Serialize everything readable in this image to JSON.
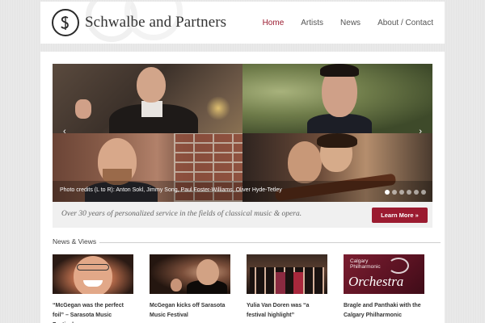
{
  "brand": {
    "name": "Schwalbe and Partners",
    "accent_color": "#9b1b30"
  },
  "nav": {
    "items": [
      {
        "label": "Home",
        "active": true
      },
      {
        "label": "Artists",
        "active": false
      },
      {
        "label": "News",
        "active": false
      },
      {
        "label": "About / Contact",
        "active": false
      }
    ]
  },
  "slider": {
    "caption": "Photo credits (L to R): Anton Sokl, Jimmy Song, Paul Foster-Williams, Oliver Hyde-Tetley",
    "prev_icon": "chevron-left-icon",
    "next_icon": "chevron-right-icon",
    "slide_count": 6,
    "active_slide": 1
  },
  "tagline": {
    "text": "Over 30 years of personalized service in the fields of classical music & opera.",
    "button_label": "Learn More »"
  },
  "news": {
    "heading": "News & Views",
    "items": [
      {
        "title": "“McGegan was the perfect foil” – Sarasota Music Festival"
      },
      {
        "title": "McGegan kicks off Sarasota Music Festival"
      },
      {
        "title": "Yulia Van Doren was “a festival highlight”"
      },
      {
        "title": "Bragle and Panthaki with the Calgary Philharmonic"
      }
    ],
    "thumb4": {
      "line1": "Calgary",
      "line2": "Philharmonic",
      "big": "Orchestra"
    }
  }
}
